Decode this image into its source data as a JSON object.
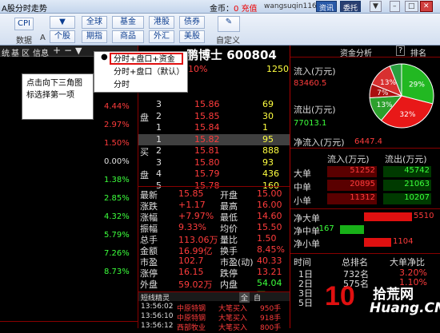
{
  "title": "A股分时走势",
  "header": {
    "coin_label": "金币：",
    "coin_value": "0",
    "recharge": "充值",
    "user": "wangsuqin116",
    "btn_info": "资讯",
    "btn_trust": "委托"
  },
  "toolbar": {
    "top": [
      "全球",
      "基金",
      "港股",
      "债券"
    ],
    "bottom": [
      "个股",
      "期指",
      "商品",
      "外汇",
      "美股"
    ],
    "left_top": "CPI",
    "left_label": "数据",
    "mid_label": "A",
    "custom": "自定义"
  },
  "stock": {
    "name": "鹏博士",
    "code": "600804"
  },
  "tabs": [
    "统",
    "基",
    "区",
    "信息"
  ],
  "chart_pcts": [
    {
      "v": "4.44%",
      "c": "red"
    },
    {
      "v": "2.97%",
      "c": "red"
    },
    {
      "v": "1.50%",
      "c": "red"
    },
    {
      "v": "0.00%",
      "c": "wht"
    },
    {
      "v": "1.38%",
      "c": "grn"
    },
    {
      "v": "2.85%",
      "c": "grn"
    },
    {
      "v": "4.32%",
      "c": "grn"
    },
    {
      "v": "5.79%",
      "c": "grn"
    },
    {
      "v": "7.26%",
      "c": "grn"
    },
    {
      "v": "8.73%",
      "c": "grn"
    }
  ],
  "orders": [
    {
      "side": "",
      "n": "3",
      "p": "15.86",
      "v": "69"
    },
    {
      "side": "盘",
      "n": "2",
      "p": "15.85",
      "v": "30"
    },
    {
      "side": "",
      "n": "1",
      "p": "15.84",
      "v": "1"
    },
    {
      "side": "",
      "n": "1",
      "p": "15.82",
      "v": "95"
    },
    {
      "side": "买",
      "n": "2",
      "p": "15.81",
      "v": "888"
    },
    {
      "side": "",
      "n": "3",
      "p": "15.80",
      "v": "93"
    },
    {
      "side": "盘",
      "n": "4",
      "p": "15.79",
      "v": "436"
    },
    {
      "side": "",
      "n": "5",
      "p": "15.78",
      "v": "160"
    }
  ],
  "order_top": {
    "p": "10%",
    "v": "1250"
  },
  "stats": [
    [
      "最新",
      "15.85",
      "开盘",
      "15.00"
    ],
    [
      "涨跌",
      "+1.17",
      "最高",
      "16.00"
    ],
    [
      "涨幅",
      "+7.97%",
      "最低",
      "14.60"
    ],
    [
      "振幅",
      "9.33%",
      "均价",
      "15.50"
    ],
    [
      "总手",
      "113.06万",
      "量比",
      "1.50"
    ],
    [
      "金额",
      "16.99亿",
      "换手",
      "8.45%"
    ],
    [
      "市盈",
      "102.7",
      "市盈(动)",
      "40.33"
    ],
    [
      "涨停",
      "16.15",
      "跌停",
      "13.21"
    ],
    [
      "外盘",
      "59.02万",
      "内盘",
      "54.04万"
    ]
  ],
  "short_title": "短线精灵",
  "short_rows": [
    {
      "t": "13:56:02",
      "n": "中原特钢",
      "a": "大笔买入",
      "v": "950手"
    },
    {
      "t": "13:56:10",
      "n": "中原特钢",
      "a": "大笔买入",
      "v": "918手"
    },
    {
      "t": "13:56:12",
      "n": "西部牧业",
      "a": "大笔买入",
      "v": "800手"
    }
  ],
  "short_tabs": [
    "全",
    "自"
  ],
  "menu": {
    "items": [
      "分时+盘口+资金",
      "分时+盘口（默认）",
      "分时"
    ],
    "selected": 0
  },
  "callout": "点击向下三角图标选择第一项",
  "cap": {
    "title": "资金分析",
    "rank": "排名",
    "in_label": "流入(万元)",
    "in_val": "83460.5",
    "out_label": "流出(万元)",
    "out_val": "77013.1",
    "net_label": "净流入(万元)",
    "net_val": "6447.4",
    "col1": "流入(万元)",
    "col2": "流出(万元)",
    "sizes": [
      {
        "n": "大单",
        "in": "51252",
        "out": "45742"
      },
      {
        "n": "中单",
        "in": "20895",
        "out": "21063"
      },
      {
        "n": "小单",
        "in": "11312",
        "out": "10207"
      }
    ],
    "net": [
      {
        "n": "净大单",
        "v": "5510",
        "c": "red"
      },
      {
        "n": "净中单",
        "v": "-167",
        "c": "grn"
      },
      {
        "n": "净小单",
        "v": "1104",
        "c": "red"
      }
    ],
    "pie": [
      {
        "v": 29,
        "label": "29%",
        "color": "#22b822"
      },
      {
        "v": 32,
        "label": "32%",
        "color": "#e81818"
      },
      {
        "v": 13,
        "label": "13%",
        "color": "#2ca02c"
      },
      {
        "v": 7,
        "label": "7%",
        "color": "#aa1010"
      },
      {
        "v": 13,
        "label": "13%",
        "color": "#d83030"
      },
      {
        "v": 6,
        "label": "",
        "color": "#2aa040"
      }
    ],
    "hist_h": [
      "时间",
      "总排名",
      "大单净比"
    ],
    "hist": [
      {
        "d": "1日",
        "r": "732名",
        "v": "3.20%"
      },
      {
        "d": "2日",
        "r": "575名",
        "v": "1.10%"
      },
      {
        "d": "3日",
        "r": "",
        "v": ""
      },
      {
        "d": "5日",
        "r": "",
        "v": ""
      }
    ]
  },
  "watermark": {
    "num": "10",
    "text": "拾荒网",
    "site": "Huang.CN"
  }
}
